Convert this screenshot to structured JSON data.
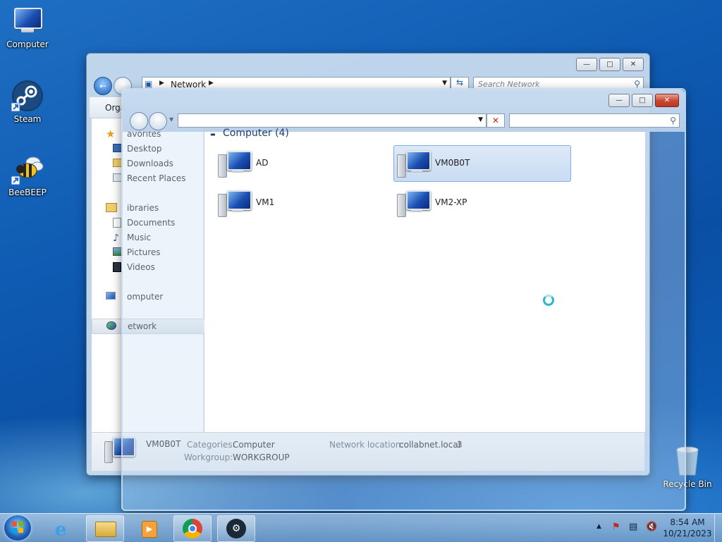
{
  "desktop": {
    "icons": [
      {
        "label": "Computer"
      },
      {
        "label": "Steam"
      },
      {
        "label": "BeeBEEP"
      },
      {
        "label": "Recycle Bin"
      }
    ]
  },
  "back_window": {
    "breadcrumb": "Network",
    "search_placeholder": "Search Network",
    "toolbar_partial": "Orga"
  },
  "nav_pane": {
    "favorites": "avorites",
    "desktop": "Desktop",
    "downloads": "Downloads",
    "recent": "Recent Places",
    "libraries": "ibraries",
    "documents": "Documents",
    "music": "Music",
    "pictures": "Pictures",
    "videos": "Videos",
    "computer": "omputer",
    "network": "etwork"
  },
  "content": {
    "group_header": "Computer (4)",
    "items": [
      {
        "name": "AD"
      },
      {
        "name": "VM0B0T"
      },
      {
        "name": "VM1"
      },
      {
        "name": "VM2-XP"
      }
    ]
  },
  "details": {
    "name": "VM0B0T",
    "categories_label": "Categories:",
    "categories_value": "Computer",
    "workgroup_label": "Workgroup:",
    "workgroup_value": "WORKGROUP",
    "netloc_label": "Network location:",
    "netloc_value": "collabnet.local",
    "netloc_extra": "3"
  },
  "clock": {
    "time": "8:54 AM",
    "date": "10/21/2023"
  },
  "colors": {
    "desktop": "#0f5bb3",
    "selection": "#c9dcf3",
    "close_button": "#c8452d"
  }
}
